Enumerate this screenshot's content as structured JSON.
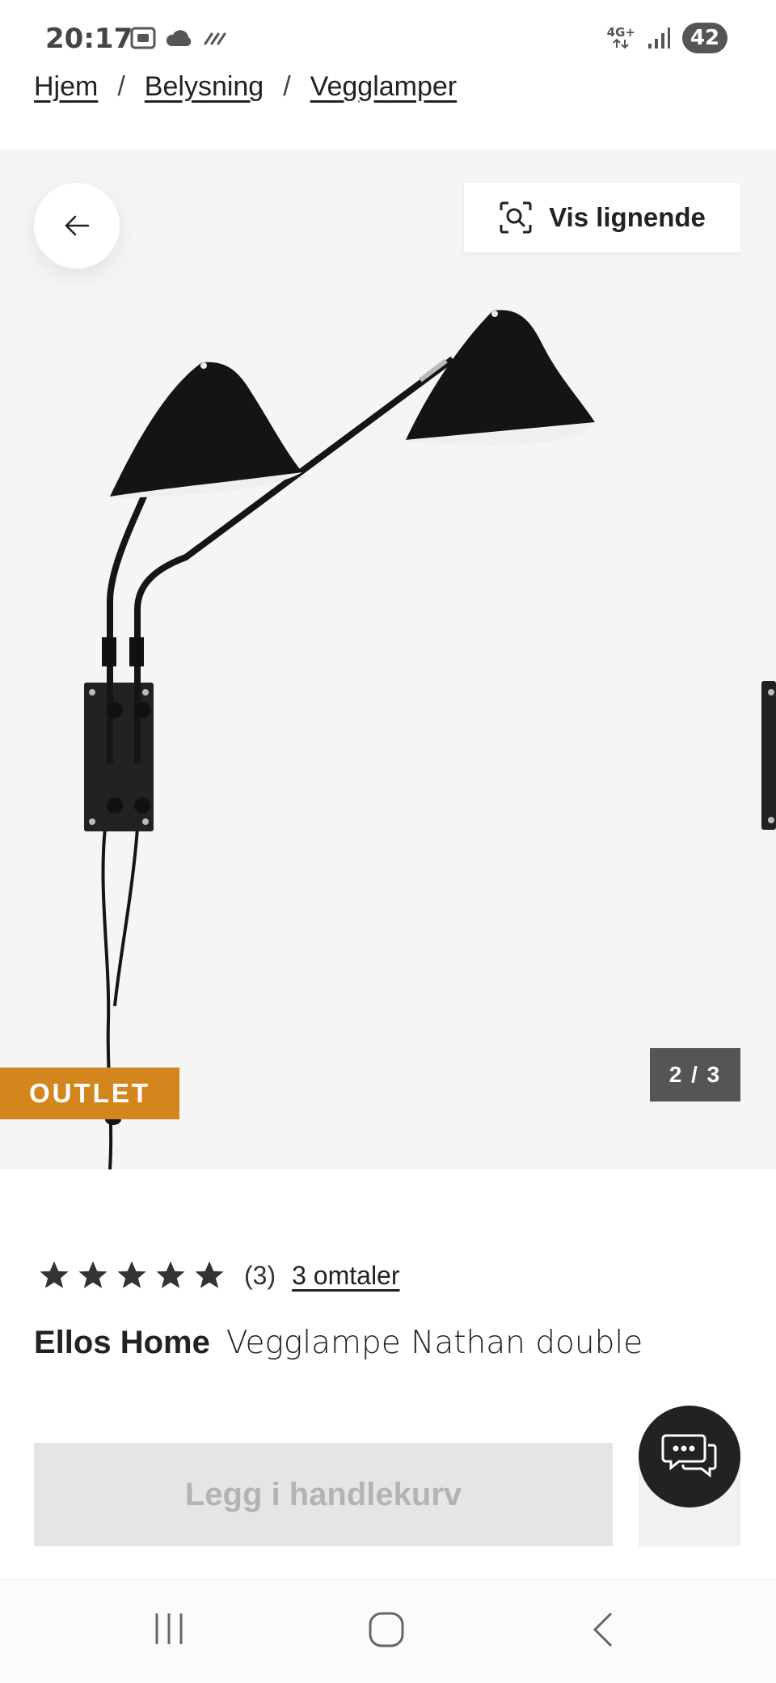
{
  "status_bar": {
    "time": "20:17",
    "network": "4G+",
    "battery": "42",
    "left_icons": [
      "screenshot-icon",
      "weather-icon",
      "haze-icon"
    ]
  },
  "breadcrumb": [
    "Hjem",
    "Belysning",
    "Vegglamper"
  ],
  "gallery": {
    "similar_label": "Vis lignende",
    "badge": "OUTLET",
    "counter": "2 / 3"
  },
  "product": {
    "rating": 5,
    "rating_count": "(3)",
    "reviews_label": "3 omtaler",
    "brand": "Ellos Home",
    "name": "Vegglampe Nathan double",
    "add_to_cart_label": "Legg i handlekurv"
  },
  "colors": {
    "badge": "#d4861e",
    "gallery_bg": "#f5f5f5",
    "disabled_button": "#e5e5e5"
  }
}
